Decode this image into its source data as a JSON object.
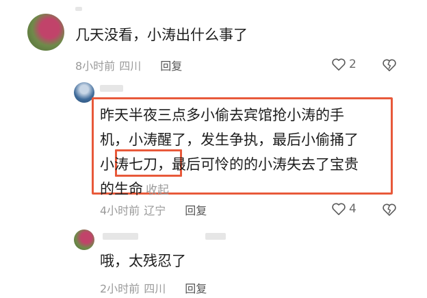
{
  "comments": [
    {
      "text": "几天没看，小涛出什么事了",
      "time": "8小时前",
      "location": "四川",
      "reply_label": "回复",
      "likes": "2"
    },
    {
      "lines": [
        "昨天半夜三点多小偷去宾馆抢小涛的手",
        "机，小涛醒了，发生争执，最后小偷捅了",
        "小涛七刀，最后可怜的的小涛失去了宝贵",
        "的生命"
      ],
      "collapse_label": "收起",
      "time": "4小时前",
      "location": "辽宁",
      "reply_label": "回复",
      "likes": "4"
    },
    {
      "text": "哦，太残忍了",
      "time": "2小时前",
      "location": "四川",
      "reply_label": "回复"
    }
  ],
  "colors": {
    "highlight": "#e8593a",
    "meta_text": "#9a9a9a"
  },
  "icons": [
    "heart-outline-icon",
    "broken-heart-icon"
  ]
}
